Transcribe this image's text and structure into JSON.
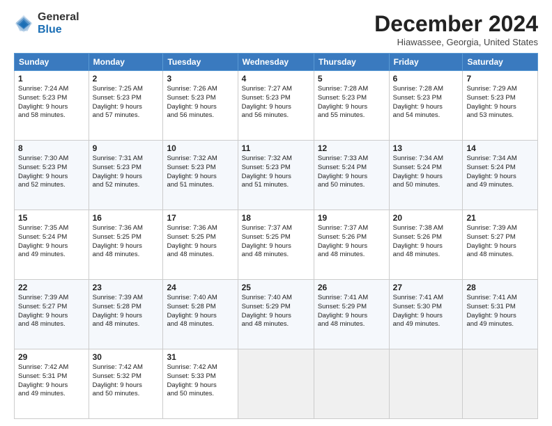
{
  "logo": {
    "general": "General",
    "blue": "Blue"
  },
  "title": "December 2024",
  "subtitle": "Hiawassee, Georgia, United States",
  "weekdays": [
    "Sunday",
    "Monday",
    "Tuesday",
    "Wednesday",
    "Thursday",
    "Friday",
    "Saturday"
  ],
  "weeks": [
    [
      {
        "day": "1",
        "lines": [
          "Sunrise: 7:24 AM",
          "Sunset: 5:23 PM",
          "Daylight: 9 hours",
          "and 58 minutes."
        ]
      },
      {
        "day": "2",
        "lines": [
          "Sunrise: 7:25 AM",
          "Sunset: 5:23 PM",
          "Daylight: 9 hours",
          "and 57 minutes."
        ]
      },
      {
        "day": "3",
        "lines": [
          "Sunrise: 7:26 AM",
          "Sunset: 5:23 PM",
          "Daylight: 9 hours",
          "and 56 minutes."
        ]
      },
      {
        "day": "4",
        "lines": [
          "Sunrise: 7:27 AM",
          "Sunset: 5:23 PM",
          "Daylight: 9 hours",
          "and 56 minutes."
        ]
      },
      {
        "day": "5",
        "lines": [
          "Sunrise: 7:28 AM",
          "Sunset: 5:23 PM",
          "Daylight: 9 hours",
          "and 55 minutes."
        ]
      },
      {
        "day": "6",
        "lines": [
          "Sunrise: 7:28 AM",
          "Sunset: 5:23 PM",
          "Daylight: 9 hours",
          "and 54 minutes."
        ]
      },
      {
        "day": "7",
        "lines": [
          "Sunrise: 7:29 AM",
          "Sunset: 5:23 PM",
          "Daylight: 9 hours",
          "and 53 minutes."
        ]
      }
    ],
    [
      {
        "day": "8",
        "lines": [
          "Sunrise: 7:30 AM",
          "Sunset: 5:23 PM",
          "Daylight: 9 hours",
          "and 52 minutes."
        ]
      },
      {
        "day": "9",
        "lines": [
          "Sunrise: 7:31 AM",
          "Sunset: 5:23 PM",
          "Daylight: 9 hours",
          "and 52 minutes."
        ]
      },
      {
        "day": "10",
        "lines": [
          "Sunrise: 7:32 AM",
          "Sunset: 5:23 PM",
          "Daylight: 9 hours",
          "and 51 minutes."
        ]
      },
      {
        "day": "11",
        "lines": [
          "Sunrise: 7:32 AM",
          "Sunset: 5:23 PM",
          "Daylight: 9 hours",
          "and 51 minutes."
        ]
      },
      {
        "day": "12",
        "lines": [
          "Sunrise: 7:33 AM",
          "Sunset: 5:24 PM",
          "Daylight: 9 hours",
          "and 50 minutes."
        ]
      },
      {
        "day": "13",
        "lines": [
          "Sunrise: 7:34 AM",
          "Sunset: 5:24 PM",
          "Daylight: 9 hours",
          "and 50 minutes."
        ]
      },
      {
        "day": "14",
        "lines": [
          "Sunrise: 7:34 AM",
          "Sunset: 5:24 PM",
          "Daylight: 9 hours",
          "and 49 minutes."
        ]
      }
    ],
    [
      {
        "day": "15",
        "lines": [
          "Sunrise: 7:35 AM",
          "Sunset: 5:24 PM",
          "Daylight: 9 hours",
          "and 49 minutes."
        ]
      },
      {
        "day": "16",
        "lines": [
          "Sunrise: 7:36 AM",
          "Sunset: 5:25 PM",
          "Daylight: 9 hours",
          "and 48 minutes."
        ]
      },
      {
        "day": "17",
        "lines": [
          "Sunrise: 7:36 AM",
          "Sunset: 5:25 PM",
          "Daylight: 9 hours",
          "and 48 minutes."
        ]
      },
      {
        "day": "18",
        "lines": [
          "Sunrise: 7:37 AM",
          "Sunset: 5:25 PM",
          "Daylight: 9 hours",
          "and 48 minutes."
        ]
      },
      {
        "day": "19",
        "lines": [
          "Sunrise: 7:37 AM",
          "Sunset: 5:26 PM",
          "Daylight: 9 hours",
          "and 48 minutes."
        ]
      },
      {
        "day": "20",
        "lines": [
          "Sunrise: 7:38 AM",
          "Sunset: 5:26 PM",
          "Daylight: 9 hours",
          "and 48 minutes."
        ]
      },
      {
        "day": "21",
        "lines": [
          "Sunrise: 7:39 AM",
          "Sunset: 5:27 PM",
          "Daylight: 9 hours",
          "and 48 minutes."
        ]
      }
    ],
    [
      {
        "day": "22",
        "lines": [
          "Sunrise: 7:39 AM",
          "Sunset: 5:27 PM",
          "Daylight: 9 hours",
          "and 48 minutes."
        ]
      },
      {
        "day": "23",
        "lines": [
          "Sunrise: 7:39 AM",
          "Sunset: 5:28 PM",
          "Daylight: 9 hours",
          "and 48 minutes."
        ]
      },
      {
        "day": "24",
        "lines": [
          "Sunrise: 7:40 AM",
          "Sunset: 5:28 PM",
          "Daylight: 9 hours",
          "and 48 minutes."
        ]
      },
      {
        "day": "25",
        "lines": [
          "Sunrise: 7:40 AM",
          "Sunset: 5:29 PM",
          "Daylight: 9 hours",
          "and 48 minutes."
        ]
      },
      {
        "day": "26",
        "lines": [
          "Sunrise: 7:41 AM",
          "Sunset: 5:29 PM",
          "Daylight: 9 hours",
          "and 48 minutes."
        ]
      },
      {
        "day": "27",
        "lines": [
          "Sunrise: 7:41 AM",
          "Sunset: 5:30 PM",
          "Daylight: 9 hours",
          "and 49 minutes."
        ]
      },
      {
        "day": "28",
        "lines": [
          "Sunrise: 7:41 AM",
          "Sunset: 5:31 PM",
          "Daylight: 9 hours",
          "and 49 minutes."
        ]
      }
    ],
    [
      {
        "day": "29",
        "lines": [
          "Sunrise: 7:42 AM",
          "Sunset: 5:31 PM",
          "Daylight: 9 hours",
          "and 49 minutes."
        ]
      },
      {
        "day": "30",
        "lines": [
          "Sunrise: 7:42 AM",
          "Sunset: 5:32 PM",
          "Daylight: 9 hours",
          "and 50 minutes."
        ]
      },
      {
        "day": "31",
        "lines": [
          "Sunrise: 7:42 AM",
          "Sunset: 5:33 PM",
          "Daylight: 9 hours",
          "and 50 minutes."
        ]
      },
      null,
      null,
      null,
      null
    ]
  ]
}
